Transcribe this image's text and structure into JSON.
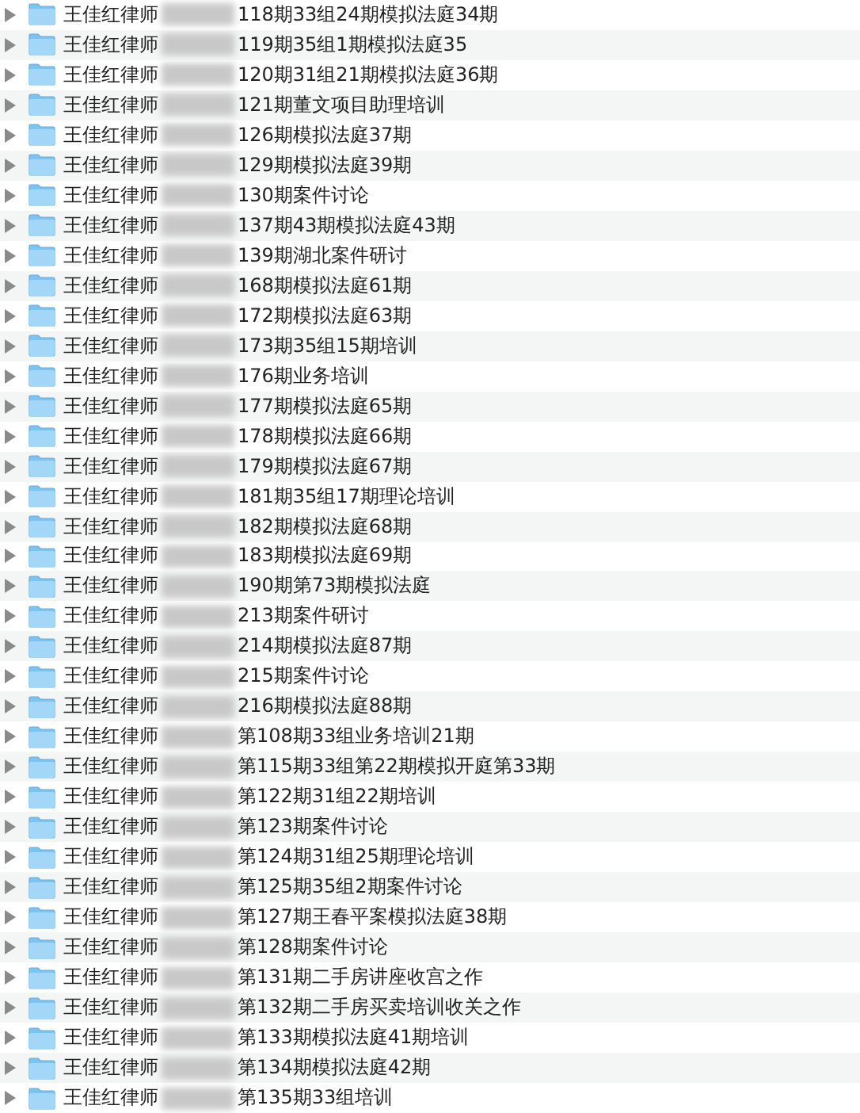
{
  "rows": [
    {
      "prefix": "王佳红律师",
      "suffix": "118期33组24期模拟法庭34期"
    },
    {
      "prefix": "王佳红律师",
      "suffix": "119期35组1期模拟法庭35"
    },
    {
      "prefix": "王佳红律师",
      "suffix": "120期31组21期模拟法庭36期"
    },
    {
      "prefix": "王佳红律师",
      "suffix": "121期董文项目助理培训"
    },
    {
      "prefix": "王佳红律师",
      "suffix": "126期模拟法庭37期"
    },
    {
      "prefix": "王佳红律师",
      "suffix": "129期模拟法庭39期"
    },
    {
      "prefix": "王佳红律师",
      "suffix": "130期案件讨论"
    },
    {
      "prefix": "王佳红律师",
      "suffix": "137期43期模拟法庭43期"
    },
    {
      "prefix": "王佳红律师",
      "suffix": "139期湖北案件研讨"
    },
    {
      "prefix": "王佳红律师",
      "suffix": "168期模拟法庭61期"
    },
    {
      "prefix": "王佳红律师",
      "suffix": "172期模拟法庭63期"
    },
    {
      "prefix": "王佳红律师",
      "suffix": "173期35组15期培训"
    },
    {
      "prefix": "王佳红律师",
      "suffix": "176期业务培训"
    },
    {
      "prefix": "王佳红律师",
      "suffix": "177期模拟法庭65期"
    },
    {
      "prefix": "王佳红律师",
      "suffix": "178期模拟法庭66期"
    },
    {
      "prefix": "王佳红律师",
      "suffix": "179期模拟法庭67期"
    },
    {
      "prefix": "王佳红律师",
      "suffix": "181期35组17期理论培训"
    },
    {
      "prefix": "王佳红律师",
      "suffix": "182期模拟法庭68期"
    },
    {
      "prefix": "王佳红律师",
      "suffix": "183期模拟法庭69期"
    },
    {
      "prefix": "王佳红律师",
      "suffix": "190期第73期模拟法庭"
    },
    {
      "prefix": "王佳红律师",
      "suffix": "213期案件研讨"
    },
    {
      "prefix": "王佳红律师",
      "suffix": "214期模拟法庭87期"
    },
    {
      "prefix": "王佳红律师",
      "suffix": "215期案件讨论"
    },
    {
      "prefix": "王佳红律师",
      "suffix": "216期模拟法庭88期"
    },
    {
      "prefix": "王佳红律师",
      "suffix": "第108期33组业务培训21期"
    },
    {
      "prefix": "王佳红律师",
      "suffix": "第115期33组第22期模拟开庭第33期"
    },
    {
      "prefix": "王佳红律师",
      "suffix": "第122期31组22期培训"
    },
    {
      "prefix": "王佳红律师",
      "suffix": "第123期案件讨论"
    },
    {
      "prefix": "王佳红律师",
      "suffix": "第124期31组25期理论培训"
    },
    {
      "prefix": "王佳红律师",
      "suffix": "第125期35组2期案件讨论"
    },
    {
      "prefix": "王佳红律师",
      "suffix": "第127期王春平案模拟法庭38期"
    },
    {
      "prefix": "王佳红律师",
      "suffix": "第128期案件讨论"
    },
    {
      "prefix": "王佳红律师",
      "suffix": "第131期二手房讲座收宫之作"
    },
    {
      "prefix": "王佳红律师",
      "suffix": "第132期二手房买卖培训收关之作"
    },
    {
      "prefix": "王佳红律师",
      "suffix": "第133期模拟法庭41期培训"
    },
    {
      "prefix": "王佳红律师",
      "suffix": "第134期模拟法庭42期"
    },
    {
      "prefix": "王佳红律师",
      "suffix": "第135期33组培训"
    }
  ]
}
